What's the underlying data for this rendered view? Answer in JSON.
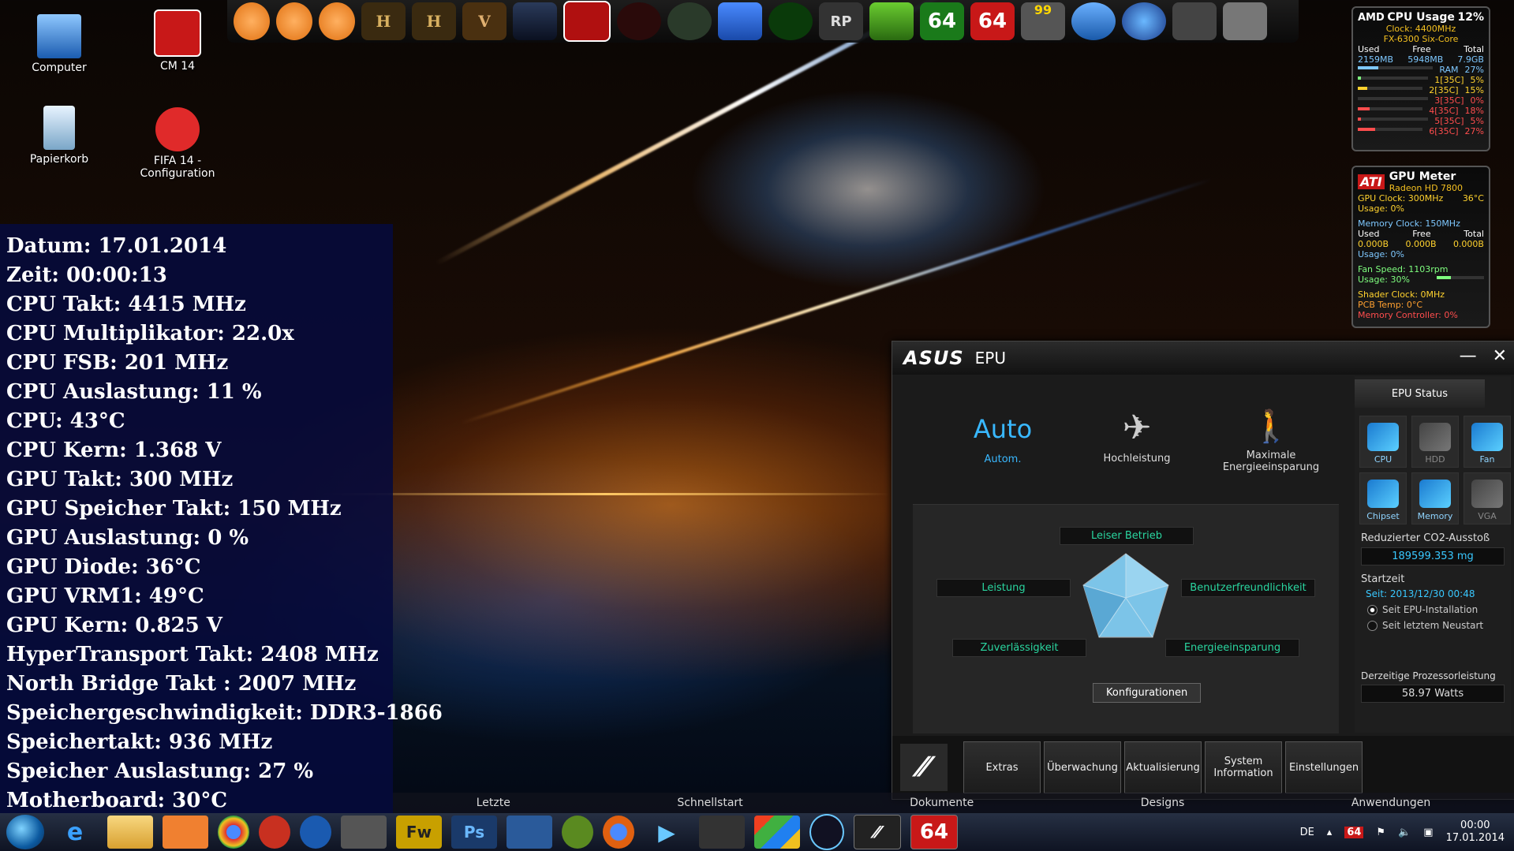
{
  "desktop": {
    "icons": [
      {
        "label": "Computer"
      },
      {
        "label": "CM 14"
      },
      {
        "label": "Papierkorb"
      },
      {
        "label": "FIFA 14 - Configuration"
      }
    ],
    "dock_icons": [
      "64",
      "64",
      "RP",
      "99"
    ]
  },
  "info": {
    "rows": [
      "Datum: 17.01.2014",
      "Zeit: 00:00:13",
      "CPU Takt: 4415 MHz",
      "CPU Multiplikator: 22.0x",
      "CPU FSB: 201 MHz",
      "CPU Auslastung: 11 %",
      "CPU: 43°C",
      "CPU Kern: 1.368 V",
      "GPU Takt: 300 MHz",
      "GPU Speicher Takt: 150 MHz",
      "GPU Auslastung: 0 %",
      "GPU Diode: 36°C",
      "GPU VRM1: 49°C",
      "GPU Kern: 0.825 V",
      "HyperTransport Takt: 2408 MHz",
      "North Bridge Takt : 2007 MHz",
      "Speichergeschwindigkeit: DDR3-1866",
      "Speichertakt: 936 MHz",
      "Speicher Auslastung: 27 %",
      "Motherboard: 30°C"
    ]
  },
  "cpu_gadget": {
    "brand": "AMD",
    "title": "CPU Usage",
    "usage": "12%",
    "clock": "Clock: 4400MHz",
    "model": "FX-6300 Six-Core",
    "headers": [
      "Used",
      "Free",
      "Total"
    ],
    "mem": [
      "2159MB",
      "5948MB",
      "7.9GB"
    ],
    "ram_label": "RAM",
    "ram_pct": "27%",
    "cores": [
      {
        "label": "1[35C]",
        "pct": "5%"
      },
      {
        "label": "2[35C]",
        "pct": "15%"
      },
      {
        "label": "3[35C]",
        "pct": "0%"
      },
      {
        "label": "4[35C]",
        "pct": "18%"
      },
      {
        "label": "5[35C]",
        "pct": "5%"
      },
      {
        "label": "6[35C]",
        "pct": "27%"
      }
    ]
  },
  "gpu_gadget": {
    "brand": "ATI",
    "title": "GPU Meter",
    "model": "Radeon HD 7800",
    "gpu_clock": "GPU Clock: 300MHz",
    "temp": "36°C",
    "usage1": "Usage: 0%",
    "mem_clock": "Memory Clock: 150MHz",
    "headers": [
      "Used",
      "Free",
      "Total"
    ],
    "mem": [
      "0.000B",
      "0.000B",
      "0.000B"
    ],
    "usage2": "Usage: 0%",
    "fan": "Fan Speed: 1103rpm",
    "usage3": "Usage: 30%",
    "shader": "Shader Clock: 0MHz",
    "pcb": "PCB Temp: 0°C",
    "memctrl": "Memory Controller: 0%"
  },
  "epu": {
    "logo": "ASUS",
    "title": "EPU",
    "mode_auto_big": "Auto",
    "mode_auto": "Autom.",
    "mode_high": "Hochleistung",
    "mode_max_line1": "Maximale",
    "mode_max_line2": "Energieeinsparung",
    "radar": {
      "top": "Leiser Betrieb",
      "left": "Leistung",
      "right": "Benutzerfreundlichkeit",
      "bottom_left": "Zuverlässigkeit",
      "bottom_right": "Energieeinsparung"
    },
    "config_button": "Konfigurationen",
    "status_tab": "EPU Status",
    "status_icons": [
      {
        "label": "CPU"
      },
      {
        "label": "HDD"
      },
      {
        "label": "Fan"
      },
      {
        "label": "Chipset"
      },
      {
        "label": "Memory"
      },
      {
        "label": "VGA"
      }
    ],
    "co2_label": "Reduzierter CO2-Ausstoß",
    "co2_value": "189599.353 mg",
    "start_label": "Startzeit",
    "start_since": "Seit: 2013/12/30 00:48",
    "radio1": "Seit EPU-Installation",
    "radio2": "Seit letztem Neustart",
    "power_label": "Derzeitige Prozessorleistung",
    "power_value": "58.97 Watts",
    "bottom_buttons": [
      "Extras",
      "Überwachung",
      "Aktualisierung",
      "System Information",
      "Einstellungen"
    ]
  },
  "taskbar": {
    "tabs": [
      "Letzte",
      "Schnellstart",
      "Dokumente",
      "Designs",
      "Anwendungen"
    ],
    "lang": "DE",
    "time": "00:00",
    "date": "17.01.2014",
    "items": [
      "Fw",
      "Ps",
      "64"
    ]
  }
}
